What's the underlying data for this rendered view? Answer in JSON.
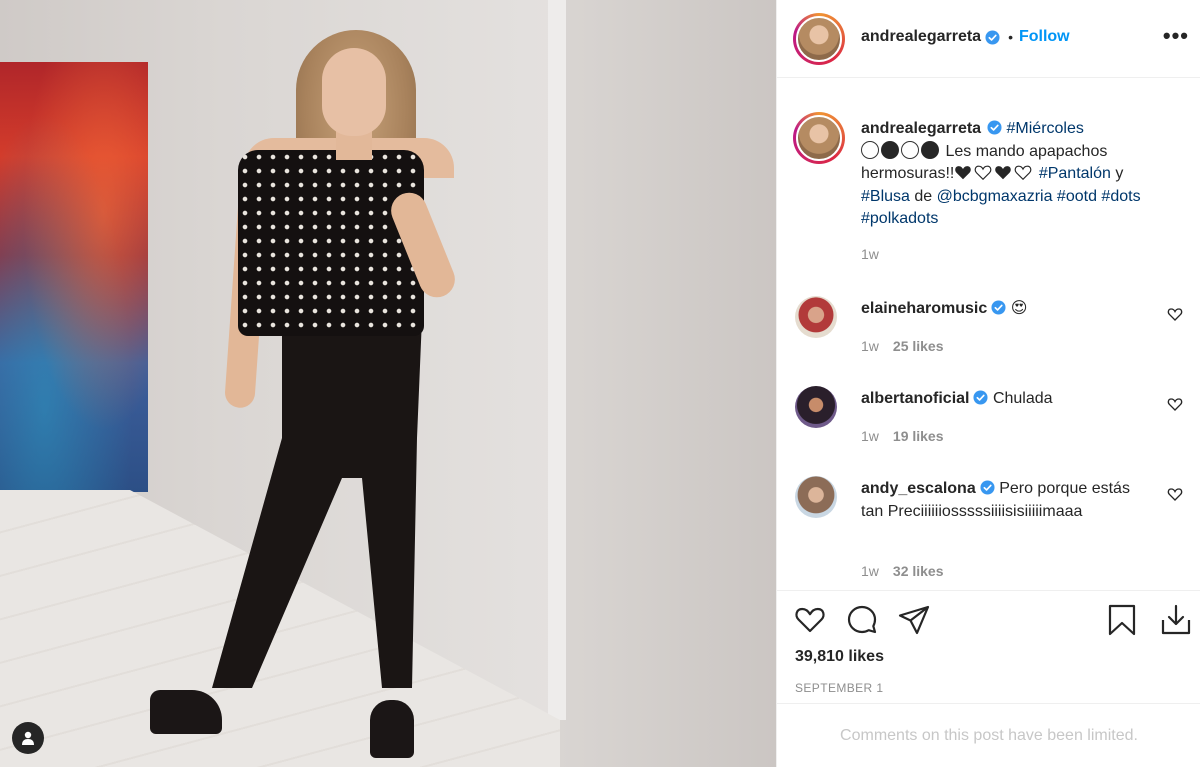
{
  "post": {
    "author": "andrealegarreta",
    "follow_label": "Follow",
    "separator": "•",
    "more_label": "•••"
  },
  "caption": {
    "author": "andrealegarreta",
    "hashtag_1": "#Miércoles",
    "circles": [
      "white",
      "black",
      "white",
      "black"
    ],
    "text_1": "Les mando apapachos hermosuras!!",
    "hearts": [
      "black",
      "white",
      "black",
      "white"
    ],
    "hashtag_2": "#Pantalón",
    "text_2": "y",
    "hashtag_3": "#Blusa",
    "text_3": "de",
    "mention": "@bcbgmaxazria",
    "hashtag_4": "#ootd",
    "hashtag_5": "#dots",
    "hashtag_6": "#polkadots",
    "time": "1w"
  },
  "comments": [
    {
      "user": "elaineharomusic",
      "text": "😍",
      "time": "1w",
      "likes": "25 likes"
    },
    {
      "user": "albertanoficial",
      "text": "Chulada",
      "time": "1w",
      "likes": "19 likes"
    },
    {
      "user": "andy_escalona",
      "text": "Pero porque estás tan Preciiiiiiosssssiiiisisiiiiimaaa",
      "time": "1w",
      "likes": "32 likes"
    }
  ],
  "stats": {
    "likes": "39,810 likes",
    "date": "SEPTEMBER 1"
  },
  "footer": {
    "limited_text": "Comments on this post have been limited."
  },
  "colors": {
    "link": "#00376b",
    "follow": "#0095f6",
    "verified": "#3897f0",
    "muted": "#8e8e8e"
  },
  "icons": [
    "user-tag-icon",
    "verified-icon",
    "more-icon",
    "heart-icon",
    "comment-icon",
    "share-icon",
    "bookmark-icon",
    "download-icon"
  ]
}
